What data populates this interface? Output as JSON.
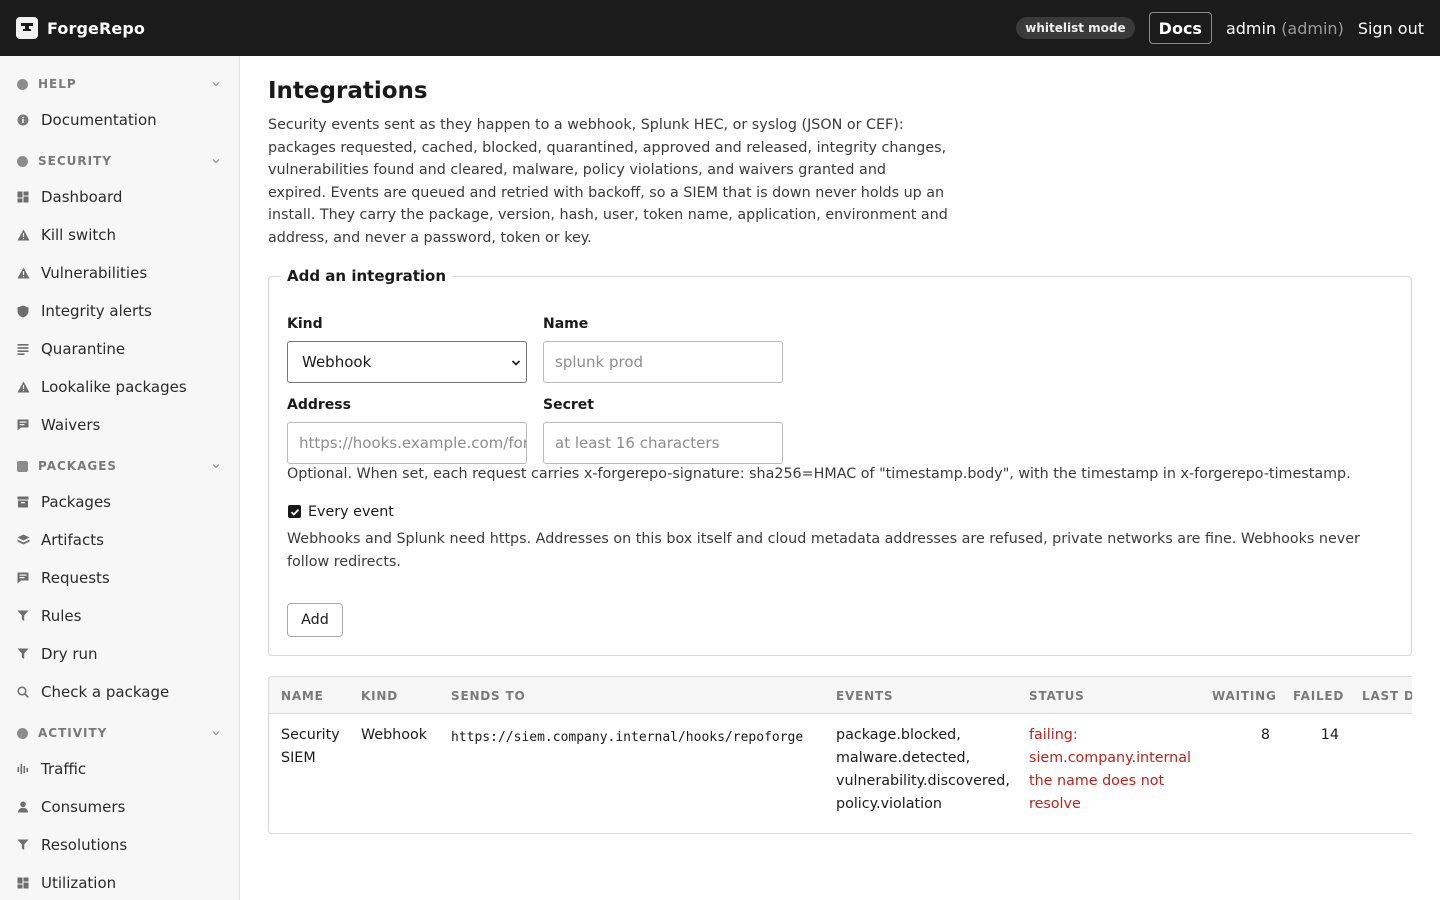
{
  "app": {
    "name": "ForgeRepo"
  },
  "header": {
    "mode_badge": "whitelist mode",
    "docs_label": "Docs",
    "user_name": "admin",
    "user_role": "(admin)",
    "signout_label": "Sign out"
  },
  "sidebar": {
    "sections": [
      {
        "label": "HELP",
        "icon": "info-icon",
        "items": [
          {
            "label": "Documentation",
            "icon": "info-icon"
          }
        ]
      },
      {
        "label": "SECURITY",
        "icon": "shield-icon",
        "items": [
          {
            "label": "Dashboard",
            "icon": "grid-icon"
          },
          {
            "label": "Kill switch",
            "icon": "warning-icon"
          },
          {
            "label": "Vulnerabilities",
            "icon": "warning-icon"
          },
          {
            "label": "Integrity alerts",
            "icon": "shield-icon"
          },
          {
            "label": "Quarantine",
            "icon": "list-icon"
          },
          {
            "label": "Lookalike packages",
            "icon": "warning-icon"
          },
          {
            "label": "Waivers",
            "icon": "note-icon"
          }
        ]
      },
      {
        "label": "PACKAGES",
        "icon": "cube-icon",
        "items": [
          {
            "label": "Packages",
            "icon": "box-icon"
          },
          {
            "label": "Artifacts",
            "icon": "cube-icon"
          },
          {
            "label": "Requests",
            "icon": "note-icon"
          },
          {
            "label": "Rules",
            "icon": "filter-icon"
          },
          {
            "label": "Dry run",
            "icon": "filter-icon"
          },
          {
            "label": "Check a package",
            "icon": "search-icon"
          }
        ]
      },
      {
        "label": "ACTIVITY",
        "icon": "clock-icon",
        "items": [
          {
            "label": "Traffic",
            "icon": "bars-icon"
          },
          {
            "label": "Consumers",
            "icon": "person-icon"
          },
          {
            "label": "Resolutions",
            "icon": "filter-icon"
          },
          {
            "label": "Utilization",
            "icon": "grid-icon"
          }
        ]
      }
    ]
  },
  "main": {
    "title": "Integrations",
    "intro": "Security events sent as they happen to a webhook, Splunk HEC, or syslog (JSON or CEF): packages requested, cached, blocked, quarantined, approved and released, integrity changes, vulnerabilities found and cleared, malware, policy violations, and waivers granted and expired. Events are queued and retried with backoff, so a SIEM that is down never holds up an install. They carry the package, version, hash, user, token name, application, environment and address, and never a password, token or key.",
    "form": {
      "legend": "Add an integration",
      "kind_label": "Kind",
      "kind_value": "Webhook",
      "name_label": "Name",
      "name_placeholder": "splunk prod",
      "address_label": "Address",
      "address_placeholder": "https://hooks.example.com/forgerepo",
      "secret_label": "Secret",
      "secret_placeholder": "at least 16 characters",
      "secret_hint": "Optional. When set, each request carries x-forgerepo-signature: sha256=HMAC of \"timestamp.body\", with the timestamp in x-forgerepo-timestamp.",
      "every_event_label": "Every event",
      "every_event_checked": true,
      "address_hint": "Webhooks and Splunk need https. Addresses on this box itself and cloud metadata addresses are refused, private networks are fine. Webhooks never follow redirects.",
      "add_label": "Add"
    },
    "table": {
      "columns": [
        "NAME",
        "KIND",
        "SENDS TO",
        "EVENTS",
        "STATUS",
        "WAITING",
        "FAILED",
        "LAST DE"
      ],
      "rows": [
        {
          "name": "Security SIEM",
          "kind": "Webhook",
          "sends_to": "https://siem.company.internal/hooks/repoforge",
          "events": "package.blocked, malware.detected, vulnerability.discovered, policy.violation",
          "status": "failing: siem.company.internal the name does not resolve",
          "waiting": "8",
          "failed": "14"
        }
      ]
    }
  },
  "colors": {
    "topbar": "#1b1b1b",
    "failing": "#b3261e",
    "sidebar_bg": "#f7f7f7"
  }
}
